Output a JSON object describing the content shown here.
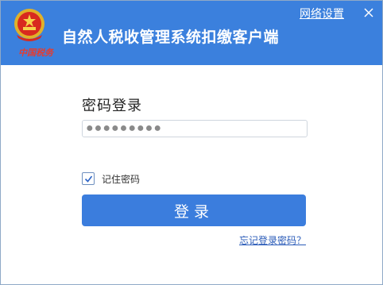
{
  "window": {
    "title": "自然人税收管理系统扣缴客户端",
    "brand_text": "中国税务",
    "network_settings_link": "网络设置",
    "close_icon": "close-icon",
    "emblem_icon": "national-emblem-icon"
  },
  "login": {
    "heading": "密码登录",
    "password_value": "●●●●●●●●●",
    "remember_label": "记住密码",
    "remember_checked": true,
    "submit_label": "登录",
    "forgot_link": "忘记登录密码？"
  },
  "colors": {
    "titlebar": "#3b80dd",
    "button": "#3b7ddd",
    "link": "#2a5bb8"
  }
}
